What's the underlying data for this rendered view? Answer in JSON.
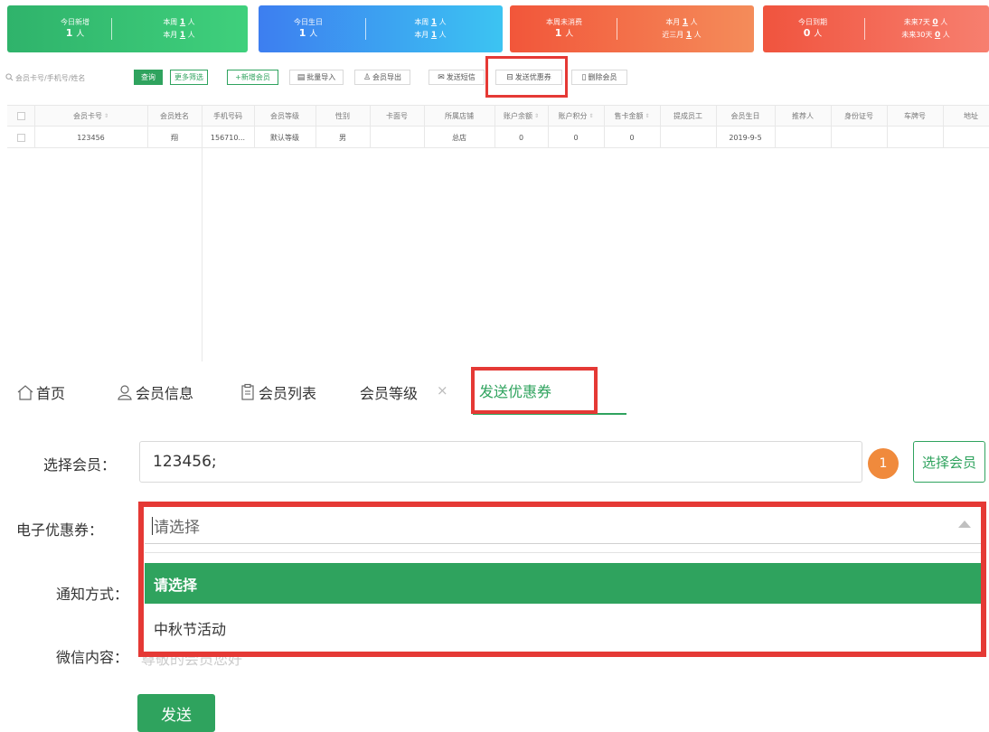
{
  "stats": [
    {
      "caption": "今日新增",
      "value": "1",
      "unit": "人",
      "right": [
        {
          "prefix": "本周",
          "value": "1",
          "unit": "人"
        },
        {
          "prefix": "本月",
          "value": "1",
          "unit": "人"
        }
      ]
    },
    {
      "caption": "今日生日",
      "value": "1",
      "unit": "人",
      "right": [
        {
          "prefix": "本周",
          "value": "1",
          "unit": "人"
        },
        {
          "prefix": "本月",
          "value": "1",
          "unit": "人"
        }
      ]
    },
    {
      "caption": "本周未消费",
      "value": "1",
      "unit": "人",
      "right": [
        {
          "prefix": "本月",
          "value": "1",
          "unit": "人"
        },
        {
          "prefix": "近三月",
          "value": "1",
          "unit": "人"
        }
      ]
    },
    {
      "caption": "今日到期",
      "value": "0",
      "unit": "人",
      "right": [
        {
          "prefix": "未来7天",
          "value": "0",
          "unit": "人"
        },
        {
          "prefix": "未来30天",
          "value": "0",
          "unit": "人"
        }
      ]
    }
  ],
  "toolbar": {
    "search_placeholder": "会员卡号/手机号/姓名",
    "query": "查询",
    "more_filter": "更多筛选",
    "add_member": "+新增会员",
    "batch_import": "批量导入",
    "export": "会员导出",
    "send_sms": "发送短信",
    "send_coupon": "发送优惠券",
    "delete": "删除会员"
  },
  "table": {
    "columns": [
      "会员卡号",
      "会员姓名",
      "手机号码",
      "会员等级",
      "性别",
      "卡面号",
      "所属店铺",
      "账户余额",
      "账户积分",
      "售卡金额",
      "提成员工",
      "会员生日",
      "推荐人",
      "身份证号",
      "车牌号",
      "地址"
    ],
    "rows": [
      [
        "123456",
        "翔",
        "156710...",
        "默认等级",
        "男",
        "",
        "总店",
        "0",
        "0",
        "0",
        "",
        "2019-9-5",
        "",
        "",
        "",
        ""
      ]
    ]
  },
  "tabs": {
    "home": "首页",
    "member_info": "会员信息",
    "member_list": "会员列表",
    "member_level": "会员等级",
    "close": "×",
    "active": "发送优惠券"
  },
  "form": {
    "select_member_label": "选择会员：",
    "member_value": "123456;",
    "member_count": "1",
    "select_member_btn": "选择会员",
    "coupon_label": "电子优惠券：",
    "coupon_placeholder": "请选择",
    "coupon_options": [
      "请选择",
      "中秋节活动"
    ],
    "notify_label": "通知方式：",
    "wechat_label": "微信内容：",
    "wechat_partial": "尊敬的会员您好",
    "send_btn": "发送"
  },
  "colors": {
    "primary_green": "#2fa35e",
    "highlight_red": "#e53935",
    "badge_orange": "#f08a3c"
  }
}
